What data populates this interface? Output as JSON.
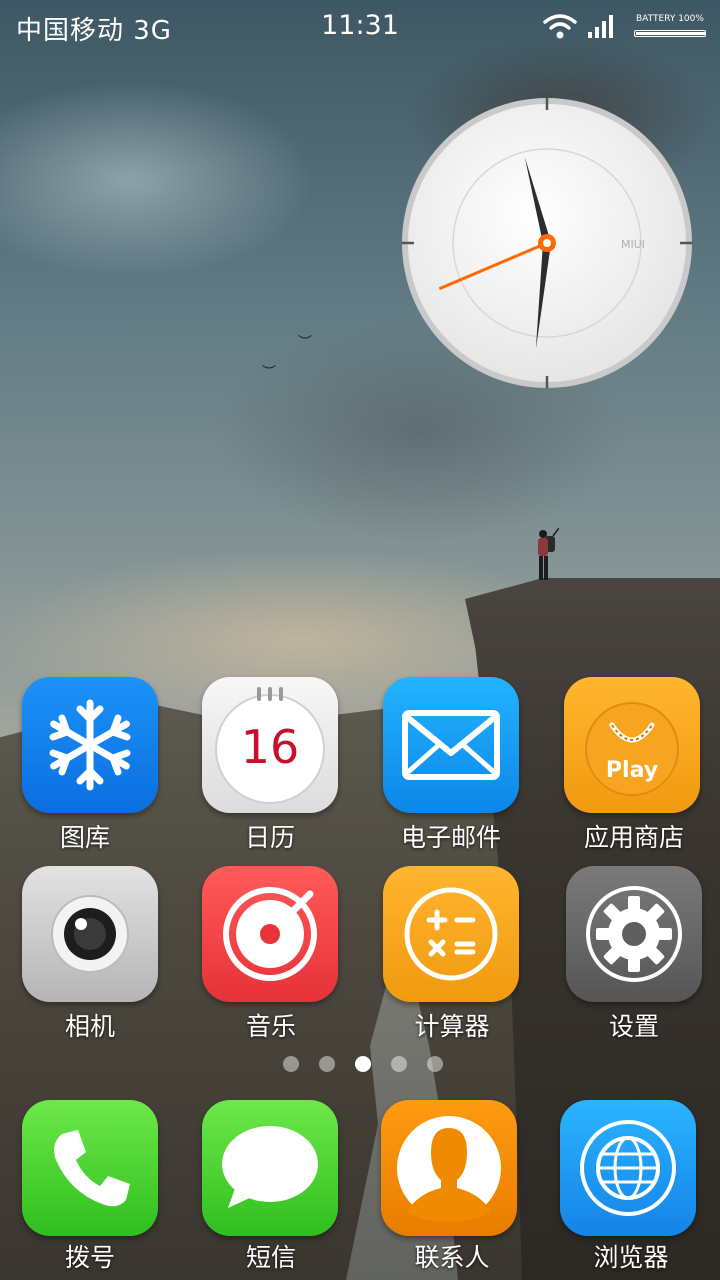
{
  "status_bar": {
    "carrier": "中国移动 3G",
    "time": "11:31",
    "battery_label": "BATTERY  100%",
    "battery_level": 100,
    "wifi_icon": "wifi-icon",
    "signal_icon": "signal-icon"
  },
  "clock_widget": {
    "brand": "MIUI",
    "hour": 11,
    "minute": 31,
    "second_hand_color": "#ff6a00"
  },
  "apps": [
    {
      "label": "图库",
      "icon": "snowflake-icon",
      "color": "#1380f0"
    },
    {
      "label": "日历",
      "icon": "calendar-icon",
      "day": "16",
      "color": "#e9e9e9"
    },
    {
      "label": "电子邮件",
      "icon": "envelope-icon",
      "color": "#1a9ff5"
    },
    {
      "label": "应用商店",
      "icon": "shopping-bag-icon",
      "badge_text": "Play",
      "color": "#f5a623"
    },
    {
      "label": "相机",
      "icon": "camera-lens-icon",
      "color": "#c8c8c8"
    },
    {
      "label": "音乐",
      "icon": "vinyl-record-icon",
      "color": "#f0464a"
    },
    {
      "label": "计算器",
      "icon": "calculator-icon",
      "color": "#f5a623"
    },
    {
      "label": "设置",
      "icon": "gear-icon",
      "color": "#707070"
    }
  ],
  "page_indicator": {
    "count": 5,
    "active": 3
  },
  "dock": [
    {
      "label": "拨号",
      "icon": "phone-icon",
      "color": "#4cd630"
    },
    {
      "label": "短信",
      "icon": "chat-bubble-icon",
      "color": "#4cd630"
    },
    {
      "label": "联系人",
      "icon": "contact-person-icon",
      "color": "#f08a00"
    },
    {
      "label": "浏览器",
      "icon": "globe-icon",
      "color": "#1a9ff5"
    }
  ]
}
